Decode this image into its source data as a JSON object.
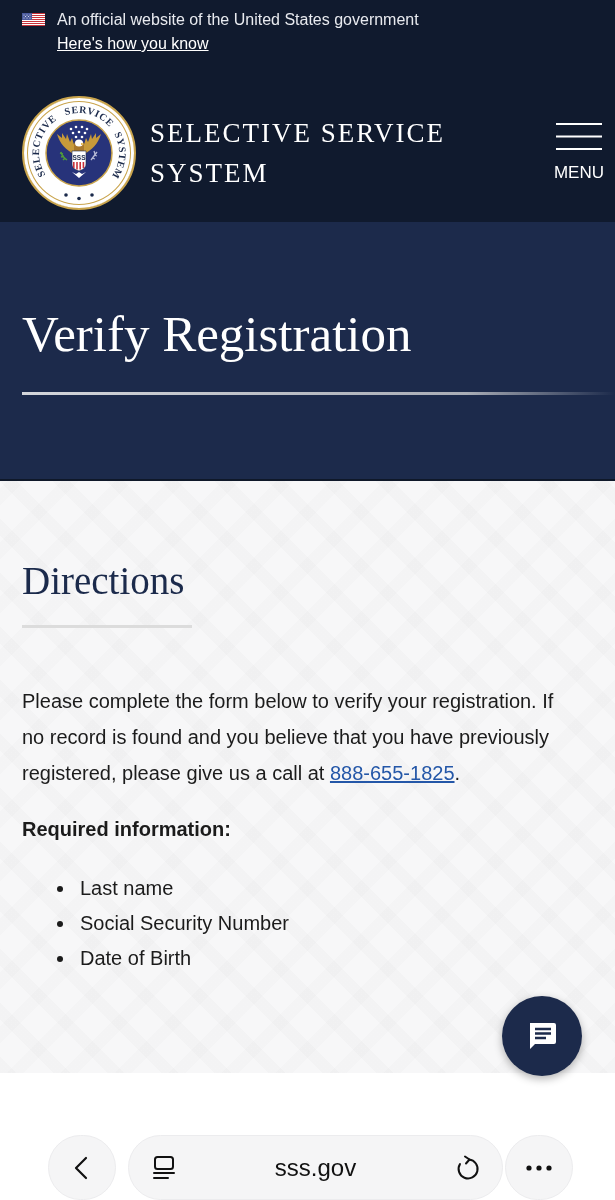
{
  "gov_banner": {
    "text": "An official website of the United States government",
    "link": "Here's how you know"
  },
  "header": {
    "seal": {
      "ring_words": [
        "SELECTIVE",
        "SERVICE",
        "SYSTEM"
      ],
      "shield_text": "SSS"
    },
    "title": "SELECTIVE SERVICE SYSTEM",
    "menu_label": "MENU"
  },
  "hero": {
    "title": "Verify Registration"
  },
  "directions": {
    "heading": "Directions",
    "paragraph": {
      "text": "Please complete the form below to verify your registration. If no record is found and you believe that you have previously registered, please give us a call at ",
      "link": "888-655-1825",
      "after": "."
    },
    "required_heading": "Required information:",
    "required_items": [
      "Last name",
      "Social Security Number",
      "Date of Birth"
    ]
  },
  "browser": {
    "url": "sss.gov"
  }
}
